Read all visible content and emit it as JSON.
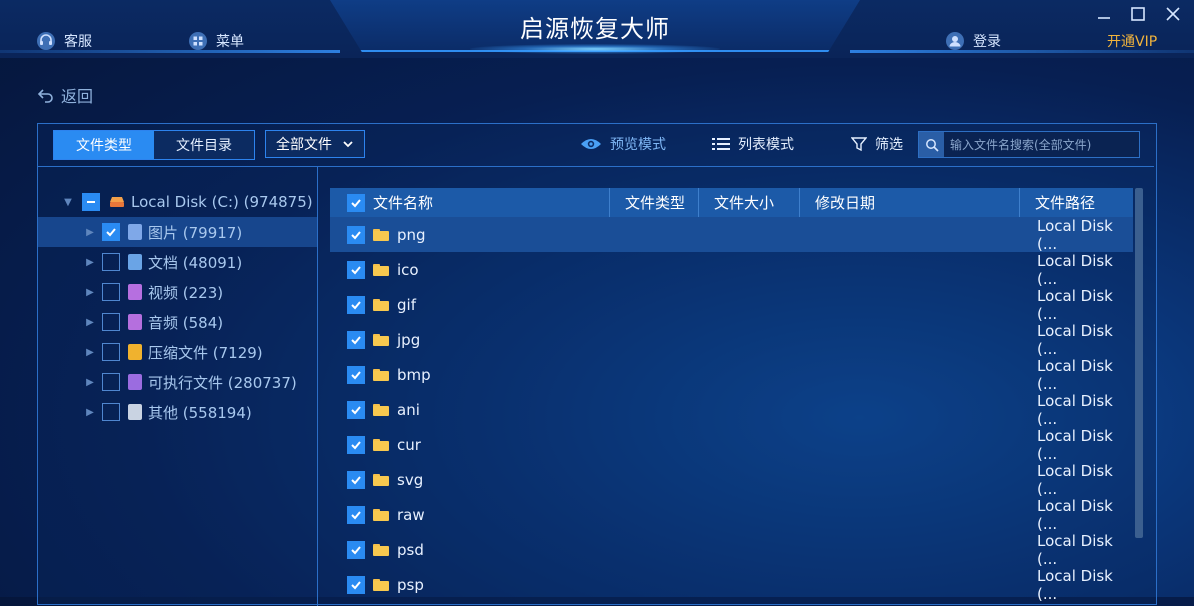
{
  "app": {
    "title": "启源恢复大师"
  },
  "topbar": {
    "service_label": "客服",
    "menu_label": "菜单",
    "login_label": "登录",
    "vip_label": "开通VIP"
  },
  "nav": {
    "back_label": "返回"
  },
  "toolbar": {
    "tabs": [
      "文件类型",
      "文件目录"
    ],
    "active_tab": "文件类型",
    "filter_select": "全部文件",
    "preview_mode": "预览模式",
    "list_mode": "列表模式",
    "filter_label": "筛选",
    "search_placeholder": "输入文件名搜索(全部文件)"
  },
  "tree": {
    "root": {
      "label": "Local Disk (C:) (974875)"
    },
    "children": [
      {
        "label": "图片 (79917)",
        "checked": true,
        "icon": "image-file-icon",
        "color": "#7fa8e8"
      },
      {
        "label": "文档 (48091)",
        "checked": false,
        "icon": "document-file-icon",
        "color": "#6aa4e6"
      },
      {
        "label": "视频 (223)",
        "checked": false,
        "icon": "video-file-icon",
        "color": "#b66fe0"
      },
      {
        "label": "音频 (584)",
        "checked": false,
        "icon": "audio-file-icon",
        "color": "#b56fde"
      },
      {
        "label": "压缩文件 (7129)",
        "checked": false,
        "icon": "archive-file-icon",
        "color": "#f0b22e"
      },
      {
        "label": "可执行文件 (280737)",
        "checked": false,
        "icon": "executable-file-icon",
        "color": "#9b6ce0"
      },
      {
        "label": "其他 (558194)",
        "checked": false,
        "icon": "other-file-icon",
        "color": "#c9d3e2"
      }
    ]
  },
  "table": {
    "headers": [
      "文件名称",
      "文件类型",
      "文件大小",
      "修改日期",
      "文件路径"
    ],
    "rows": [
      {
        "name": "png",
        "path": "Local Disk (..."
      },
      {
        "name": "ico",
        "path": "Local Disk (..."
      },
      {
        "name": "gif",
        "path": "Local Disk (..."
      },
      {
        "name": "jpg",
        "path": "Local Disk (..."
      },
      {
        "name": "bmp",
        "path": "Local Disk (..."
      },
      {
        "name": "ani",
        "path": "Local Disk (..."
      },
      {
        "name": "cur",
        "path": "Local Disk (..."
      },
      {
        "name": "svg",
        "path": "Local Disk (..."
      },
      {
        "name": "raw",
        "path": "Local Disk (..."
      },
      {
        "name": "psd",
        "path": "Local Disk (..."
      },
      {
        "name": "psp",
        "path": "Local Disk (..."
      }
    ]
  },
  "colors": {
    "accent": "#2a8bf2",
    "vip": "#f2b43c",
    "background": "#071f52"
  }
}
